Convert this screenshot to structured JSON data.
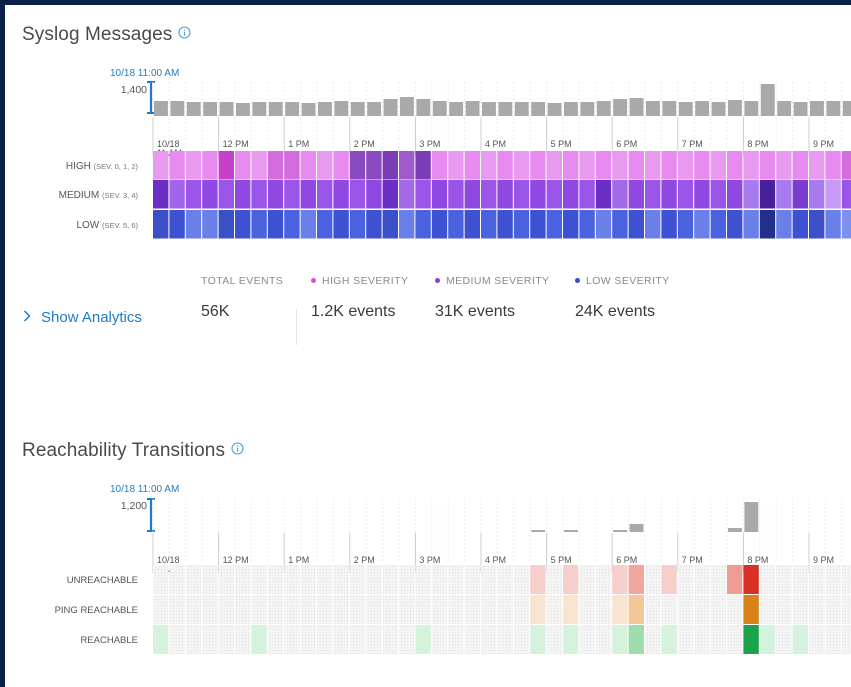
{
  "syslog": {
    "title": "Syslog Messages",
    "info_icon": "info-circle-icon",
    "time_label": "10/18 11:00 AM",
    "y_max_label": "1,400",
    "x_ticks": [
      "10/18\n11 AM",
      "12 PM",
      "1 PM",
      "2 PM",
      "3 PM",
      "4 PM",
      "5 PM",
      "6 PM",
      "7 PM",
      "8 PM",
      "9 PM"
    ],
    "rows": [
      "HIGH (SEV. 0, 1, 2)",
      "MEDIUM (SEV. 3, 4)",
      "LOW (SEV. 5, 6)"
    ],
    "colors": {
      "high": "#e07fe6",
      "medium": "#8a44e0",
      "low": "#4a59d9",
      "bars": "#a9a9a9"
    }
  },
  "analytics": {
    "toggle_label": "Show Analytics",
    "stats": [
      {
        "label": "TOTAL EVENTS",
        "value": "56K",
        "dot": ""
      },
      {
        "label": "HIGH SEVERITY",
        "value": "1.2K events",
        "dot": "#d94fdc"
      },
      {
        "label": "MEDIUM SEVERITY",
        "value": "31K events",
        "dot": "#8a3fe0"
      },
      {
        "label": "LOW SEVERITY",
        "value": "24K events",
        "dot": "#3a48c9"
      }
    ]
  },
  "reach": {
    "title": "Reachability Transitions",
    "info_icon": "info-circle-icon",
    "time_label": "10/18 11:00 AM",
    "y_max_label": "1,200",
    "x_ticks": [
      "10/18\n11 AM",
      "12 PM",
      "1 PM",
      "2 PM",
      "3 PM",
      "4 PM",
      "5 PM",
      "6 PM",
      "7 PM",
      "8 PM",
      "9 PM"
    ],
    "rows": [
      "UNREACHABLE",
      "PING REACHABLE",
      "REACHABLE"
    ],
    "colors": {
      "unreachable": "#d93025",
      "ping": "#d9821a",
      "reachable": "#1aa34a",
      "bars": "#a9a9a9"
    }
  }
}
